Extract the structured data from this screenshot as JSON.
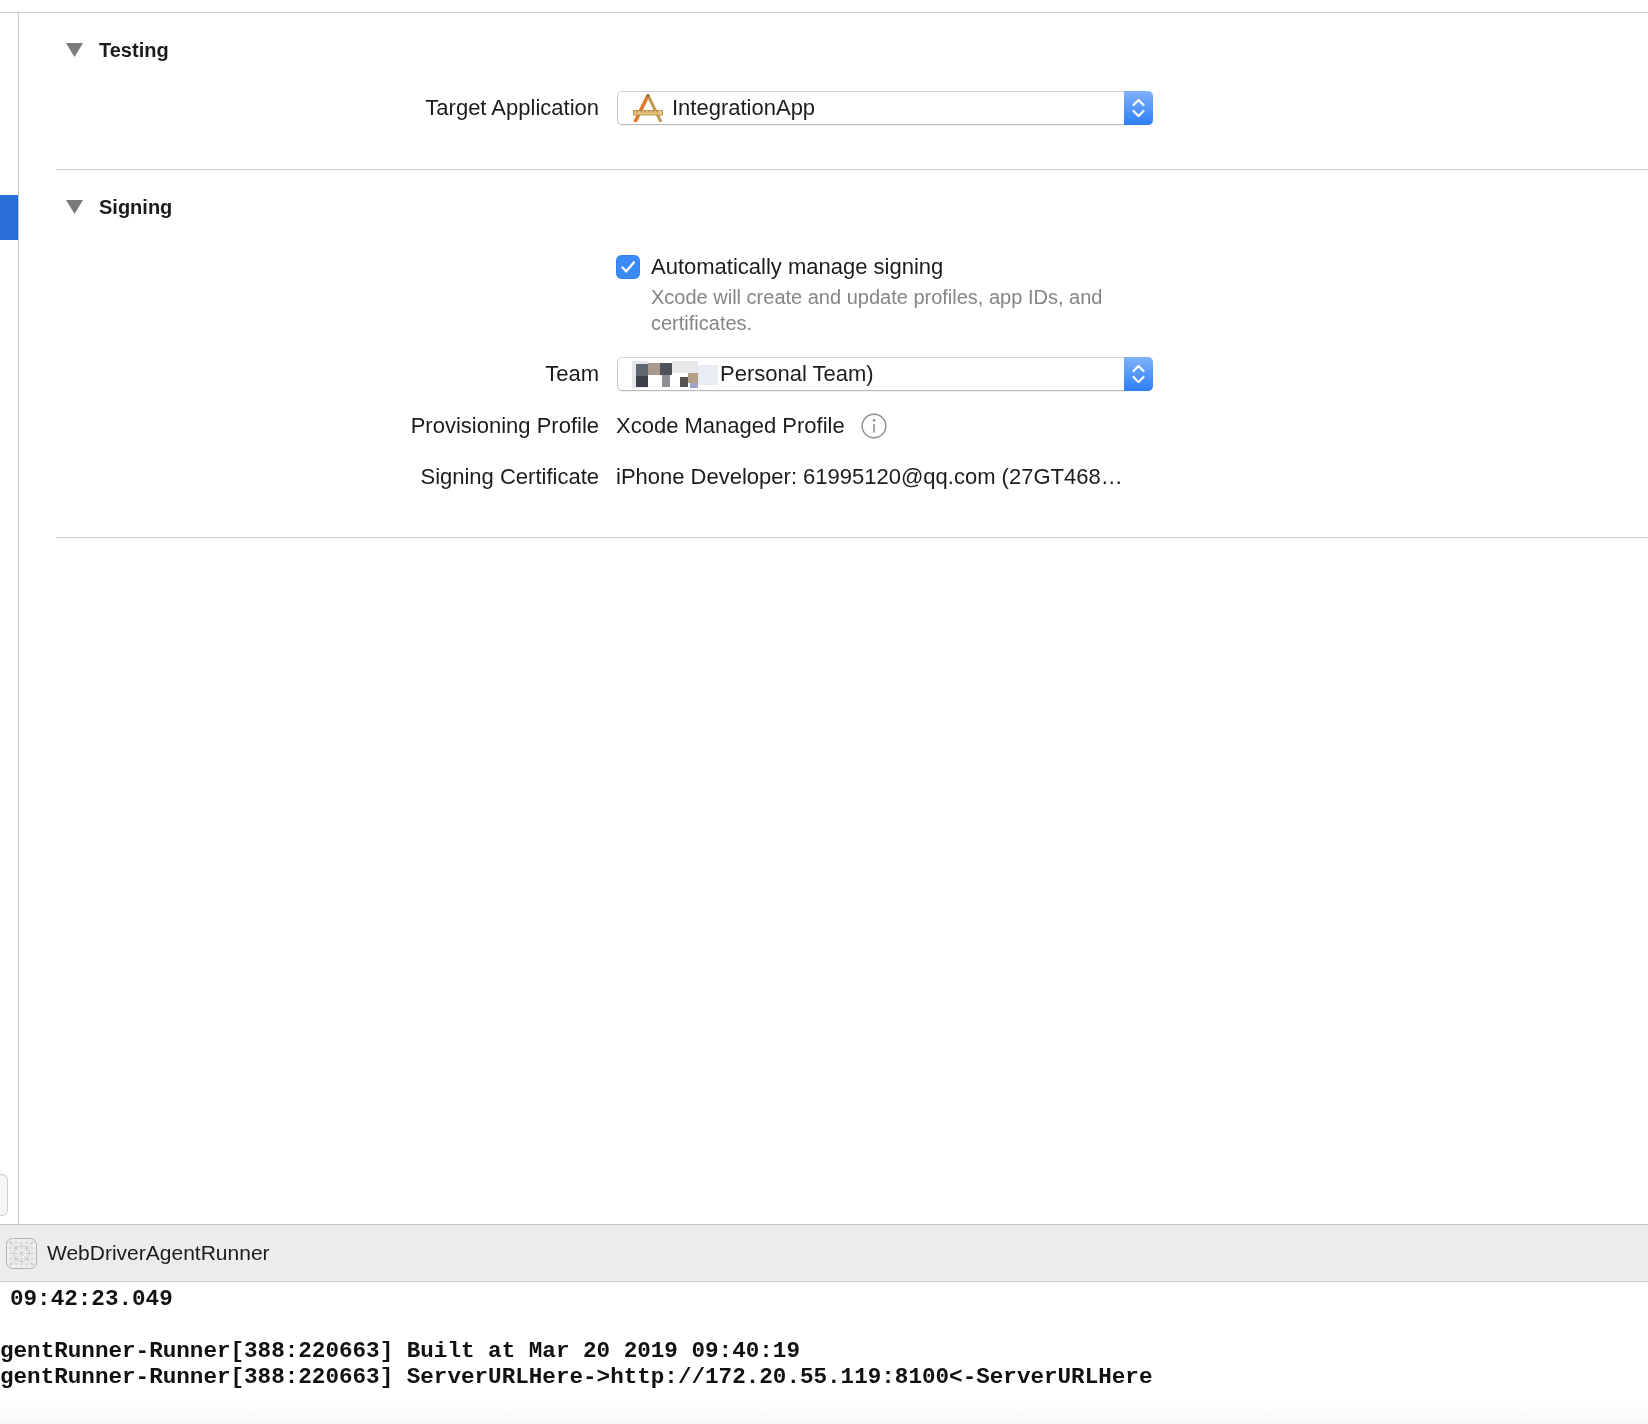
{
  "sidebar": {
    "items": [
      {
        "selected": true
      }
    ]
  },
  "sections": [
    {
      "title": "Testing",
      "expanded": true,
      "rows": [
        {
          "kind": "popup",
          "label": "Target Application",
          "value": "IntegrationApp"
        }
      ]
    },
    {
      "title": "Signing",
      "expanded": true,
      "rows": [
        {
          "kind": "checkbox",
          "label": "Automatically manage signing",
          "checked": true,
          "description": "Xcode will create and update profiles, app IDs, and certificates."
        },
        {
          "kind": "masked",
          "label": "Team",
          "value": "Personal Team)"
        },
        {
          "kind": "info",
          "label": "Provisioning Profile",
          "value": "Xcode Managed Profile"
        },
        {
          "kind": "text",
          "label": "Signing Certificate",
          "value": "iPhone Developer: 61995120@qq.com (27GT468…"
        }
      ]
    }
  ],
  "debug_bar": {
    "target": "WebDriverAgentRunner"
  },
  "console": {
    "entries": [
      {
        "kind": "timestamp",
        "lines": [
          "09:42:23.049"
        ]
      },
      {
        "kind": "log",
        "lines": [
          "gentRunner-Runner[388:220663] Built at Mar 20 2019 09:40:19",
          "gentRunner-Runner[388:220663] ServerURLHere->http://172.20.55.119:8100<-ServerURLHere"
        ]
      }
    ]
  }
}
